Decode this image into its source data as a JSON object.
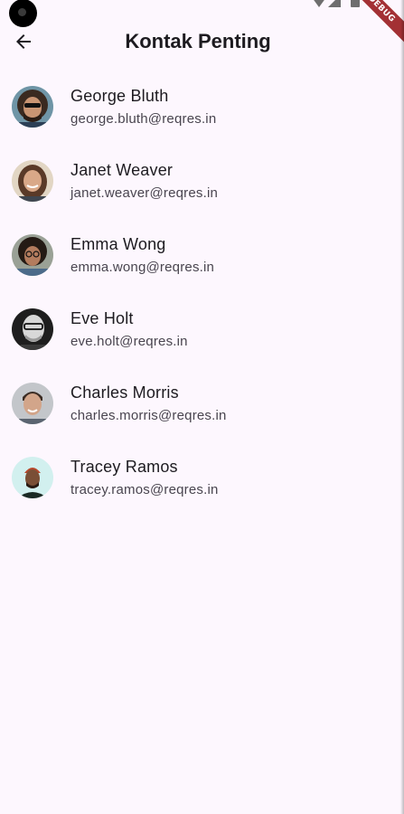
{
  "app_bar": {
    "title": "Kontak Penting",
    "back_icon": "arrow-back-icon"
  },
  "debug_banner": "DEBUG",
  "contacts": [
    {
      "name": "George Bluth",
      "email": "george.bluth@reqres.in",
      "avatar_bg": "#5b7f8f"
    },
    {
      "name": "Janet Weaver",
      "email": "janet.weaver@reqres.in",
      "avatar_bg": "#d9cbb8"
    },
    {
      "name": "Emma Wong",
      "email": "emma.wong@reqres.in",
      "avatar_bg": "#8a8e86"
    },
    {
      "name": "Eve Holt",
      "email": "eve.holt@reqres.in",
      "avatar_bg": "#2b2b2b"
    },
    {
      "name": "Charles Morris",
      "email": "charles.morris@reqres.in",
      "avatar_bg": "#b9bcc0"
    },
    {
      "name": "Tracey Ramos",
      "email": "tracey.ramos@reqres.in",
      "avatar_bg": "#cfeeee"
    }
  ],
  "colors": {
    "background": "#fdf7fe",
    "primary_text": "#1d1b20",
    "secondary_text": "#49454f",
    "debug_banner": "#a33034"
  }
}
